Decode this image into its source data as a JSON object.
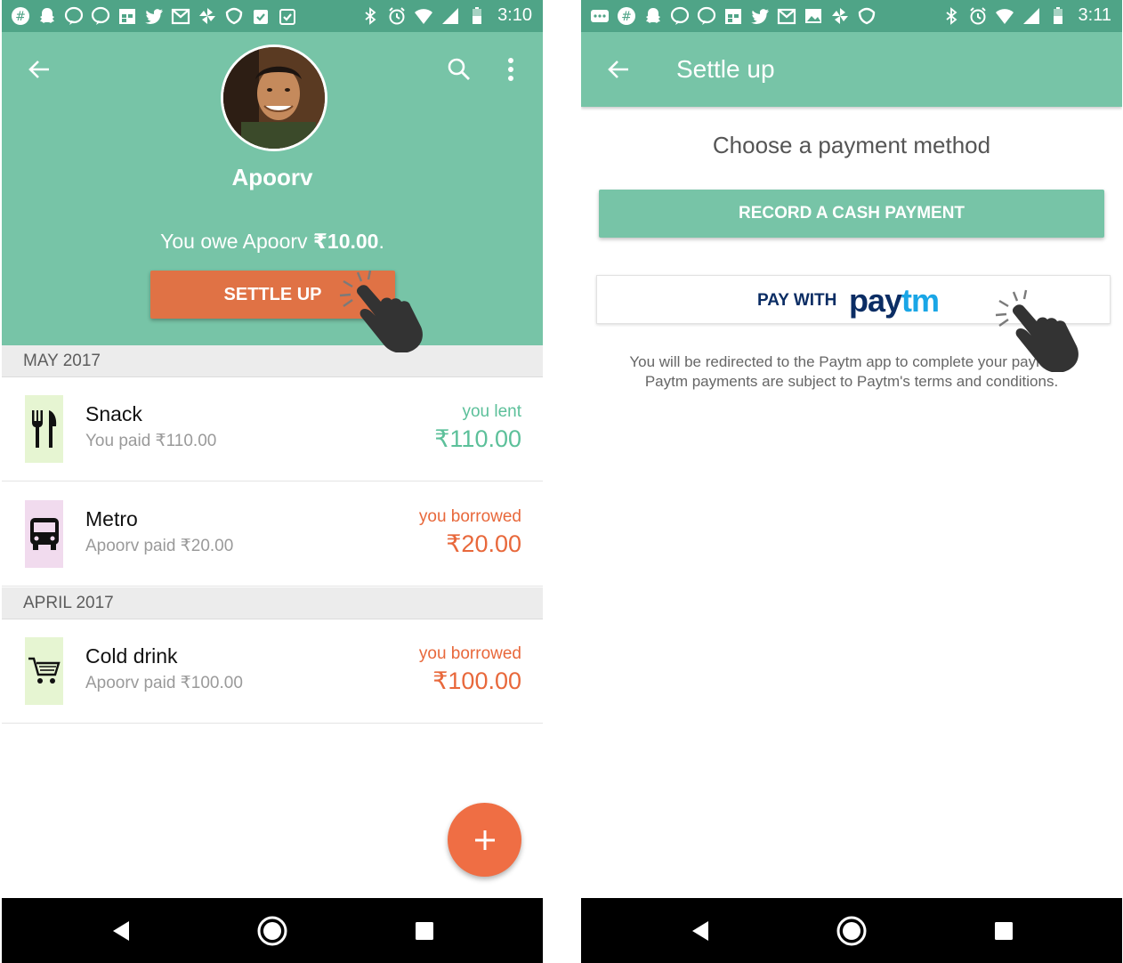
{
  "left_screen": {
    "status_bar": {
      "time": "3:10"
    },
    "header": {
      "name": "Apoorv",
      "balance_prefix": "You owe Apoorv ",
      "balance_amount": "₹10.00",
      "balance_suffix": ".",
      "settle_label": "SETTLE UP"
    },
    "sections": [
      {
        "label": "MAY 2017",
        "items": [
          {
            "title": "Snack",
            "subtitle": "You paid ₹110.00",
            "status": "you lent",
            "amount": "₹110.00",
            "icon": "fork-knife-icon",
            "tile_color": "#e6f5d2",
            "status_color": "#5cc09a"
          },
          {
            "title": "Metro",
            "subtitle": "Apoorv paid ₹20.00",
            "status": "you borrowed",
            "amount": "₹20.00",
            "icon": "bus-icon",
            "tile_color": "#f1dbee",
            "status_color": "#e8683b"
          }
        ]
      },
      {
        "label": "APRIL 2017",
        "items": [
          {
            "title": "Cold drink",
            "subtitle": "Apoorv paid ₹100.00",
            "status": "you borrowed",
            "amount": "₹100.00",
            "icon": "shopping-cart-icon",
            "tile_color": "#e6f5d2",
            "status_color": "#e8683b"
          }
        ]
      }
    ]
  },
  "right_screen": {
    "status_bar": {
      "time": "3:11"
    },
    "toolbar": {
      "title": "Settle up"
    },
    "heading": "Choose a payment method",
    "cash_button": "RECORD A CASH PAYMENT",
    "paytm_button": {
      "prefix": "PAY WITH",
      "logo_pay": "pay",
      "logo_tm": "tm"
    },
    "note_line1": "You will be redirected to the Paytm app to complete your payment.",
    "note_line2": "Paytm payments are subject to Paytm's terms and conditions."
  },
  "colors": {
    "primary": "#77c4a7",
    "status_bar": "#4fa487",
    "accent_orange": "#e07245",
    "lent_green": "#5cc09a",
    "borrowed_orange": "#e8683b",
    "paytm_navy": "#0b2d64",
    "paytm_blue": "#1aa6e6"
  }
}
